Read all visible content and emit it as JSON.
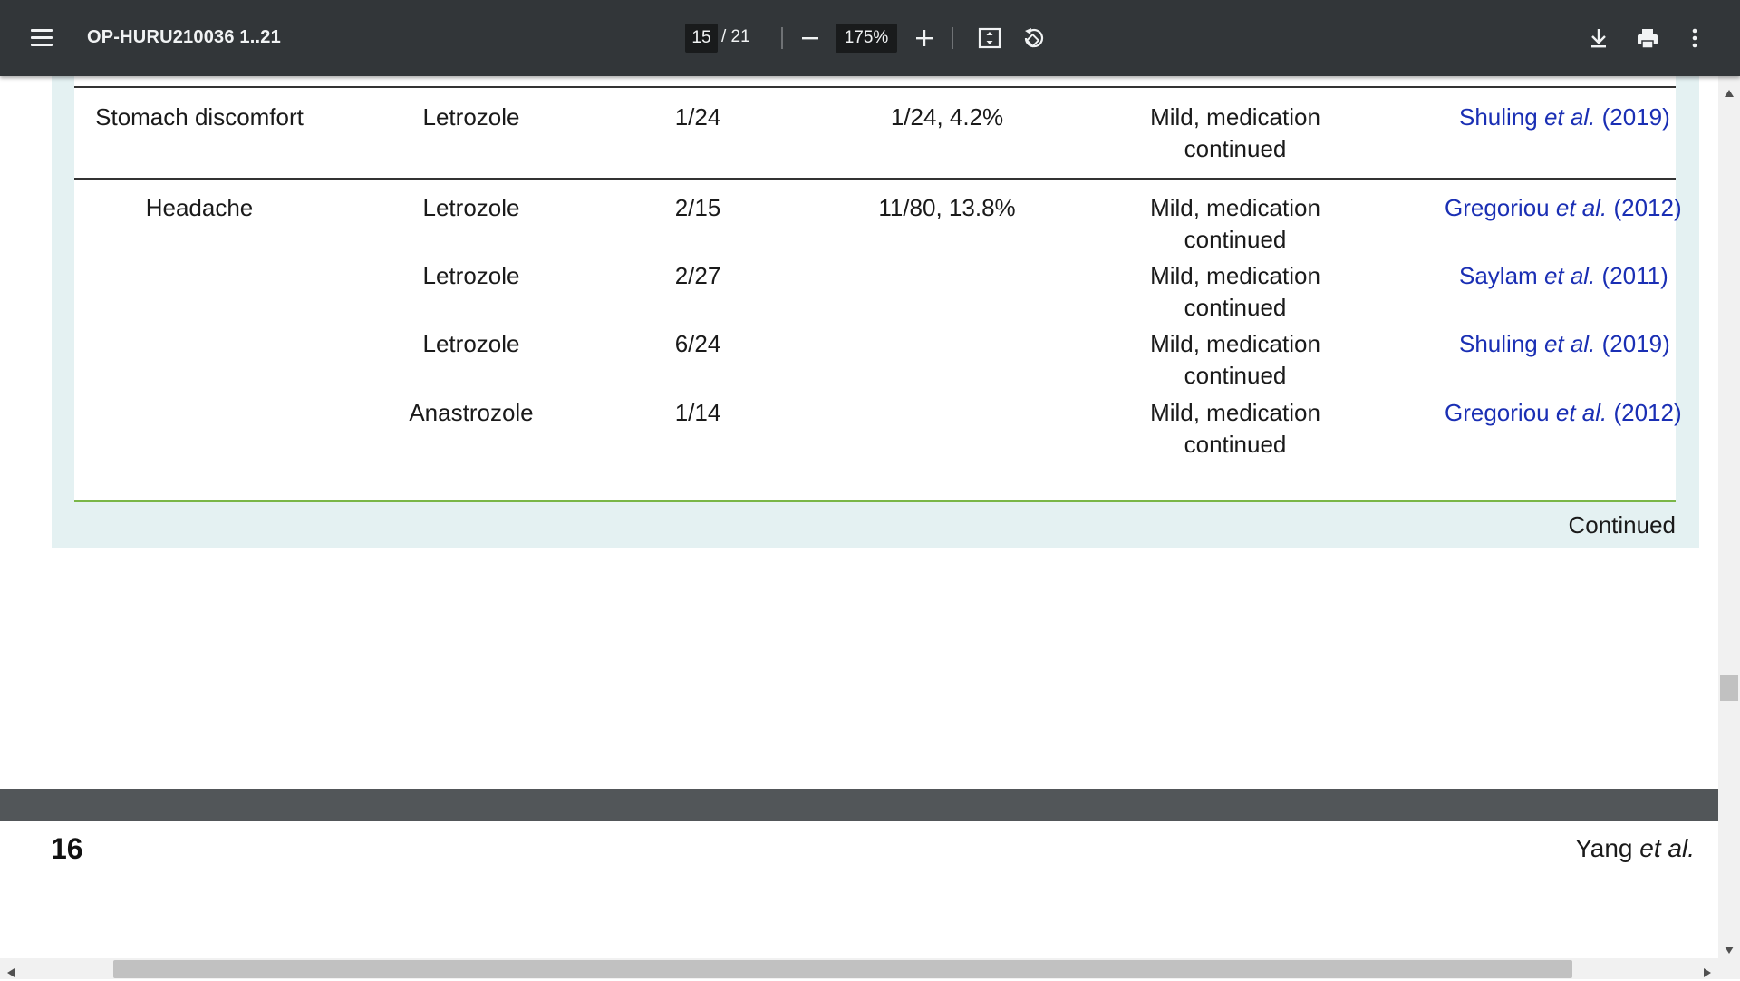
{
  "toolbar": {
    "menu_icon": "hamburger-menu-icon",
    "title": "OP-HURU210036 1..21",
    "page_current": "15",
    "page_total": "/ 21",
    "zoom": "175%",
    "icons": [
      "zoom-out-icon",
      "zoom-in-icon",
      "fit-page-icon",
      "rotate-icon",
      "download-icon",
      "print-icon",
      "more-vert-icon"
    ]
  },
  "table": {
    "rows": [
      {
        "effect": "Stomach discomfort",
        "drug": "Letrozole",
        "n": "1/24",
        "total": "1/24, 4.2%",
        "severity": "Mild, medication continued",
        "ref_author": "Shuling",
        "ref_etal": "et al.",
        "ref_year": "(2019)"
      },
      {
        "effect": "Headache",
        "drug": "Letrozole",
        "n": "2/15",
        "total": "11/80, 13.8%",
        "severity": "Mild, medication continued",
        "ref_author": "Gregoriou",
        "ref_etal": "et al.",
        "ref_year": "(2012)"
      },
      {
        "effect": "",
        "drug": "Letrozole",
        "n": "2/27",
        "total": "",
        "severity": "Mild, medication continued",
        "ref_author": "Saylam",
        "ref_etal": "et al.",
        "ref_year": "(2011)"
      },
      {
        "effect": "",
        "drug": "Letrozole",
        "n": "6/24",
        "total": "",
        "severity": "Mild, medication continued",
        "ref_author": "Shuling",
        "ref_etal": "et al.",
        "ref_year": "(2019)"
      },
      {
        "effect": "",
        "drug": "Anastrozole",
        "n": "1/14",
        "total": "",
        "severity": "Mild, medication continued",
        "ref_author": "Gregoriou",
        "ref_etal": "et al.",
        "ref_year": "(2012)"
      }
    ],
    "continued": "Continued"
  },
  "page2": {
    "page_number": "16",
    "running_head_author": "Yang",
    "running_head_etal": "et al."
  },
  "colors": {
    "toolbar_bg": "#323639",
    "viewer_bg": "#525659",
    "table_band": "#e4f1f2",
    "link": "#1a2fb4",
    "green_rule": "#7ab648"
  }
}
